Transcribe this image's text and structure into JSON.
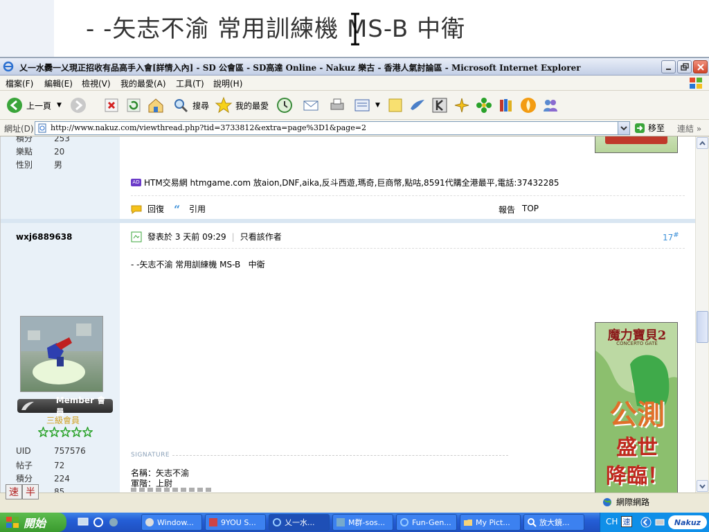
{
  "zoom_banner": {
    "text": "- -矢志不渝 常用訓練機 MS-B   中衛"
  },
  "window": {
    "title": "乂一水爨一乂現正招收有品高手入會[詳情入內] - SD 公會區 - SD高達 Online - Nakuz 樂古 - 香港人氣討論區 - Microsoft Internet Explorer"
  },
  "menu": [
    "檔案(F)",
    "編輯(E)",
    "檢視(V)",
    "我的最愛(A)",
    "工具(T)",
    "說明(H)"
  ],
  "toolbar": {
    "back_label": "上一頁",
    "search_label": "搜尋",
    "favorites_label": "我的最愛"
  },
  "address": {
    "label": "網址(D)",
    "url": "http://www.nakuz.com/viewthread.php?tid=3733812&extra=page%3D1&page=2",
    "go_label": "移至",
    "links_label": "連結"
  },
  "prev_post": {
    "stats": [
      {
        "k": "積分",
        "v": "253"
      },
      {
        "k": "樂點",
        "v": "20"
      },
      {
        "k": "性別",
        "v": "男"
      }
    ],
    "ad_text": "HTM交易網 htmgame.com 放aion,DNF,aika,反斗西遊,瑪奇,巨商幣,點咕,8591代購全港最平,電話:37432285",
    "reply_label": "回復",
    "quote_label": "引用",
    "report_label": "報告",
    "top_label": "TOP"
  },
  "post": {
    "username": "wxj6889638",
    "member_badge": "Member 會員",
    "rank": "三級會員",
    "stats": [
      {
        "k": "UID",
        "v": "757576"
      },
      {
        "k": "帖子",
        "v": "72"
      },
      {
        "k": "積分",
        "v": "224"
      },
      {
        "k": "樂點",
        "v": "85"
      }
    ],
    "posted": "發表於 3 天前 09:29",
    "only_author": "只看該作者",
    "floor": "17",
    "floor_mark": "#",
    "content": "- -矢志不渝 常用訓練機 MS-B   中衛",
    "signature_label": "SIGNATURE",
    "sig_lines": [
      "名稱：矢志不渝",
      "軍階：上尉"
    ]
  },
  "ad": {
    "title": "魔力寶貝2",
    "subtitle": "CONCERTO GATE",
    "line1": "公測",
    "line2": "盛世",
    "line3": "降臨！"
  },
  "statusbar": {
    "zone": "網際網路"
  },
  "ime": [
    "速",
    "半"
  ],
  "taskbar": {
    "start": "開始",
    "tasks": [
      "Window...",
      "9YOU S...",
      "乂一水...",
      "M群-sos...",
      "Fun-Gen...",
      "My Pict...",
      "放大鏡..."
    ],
    "lang": "CH",
    "tray_app": "Nakuz"
  }
}
